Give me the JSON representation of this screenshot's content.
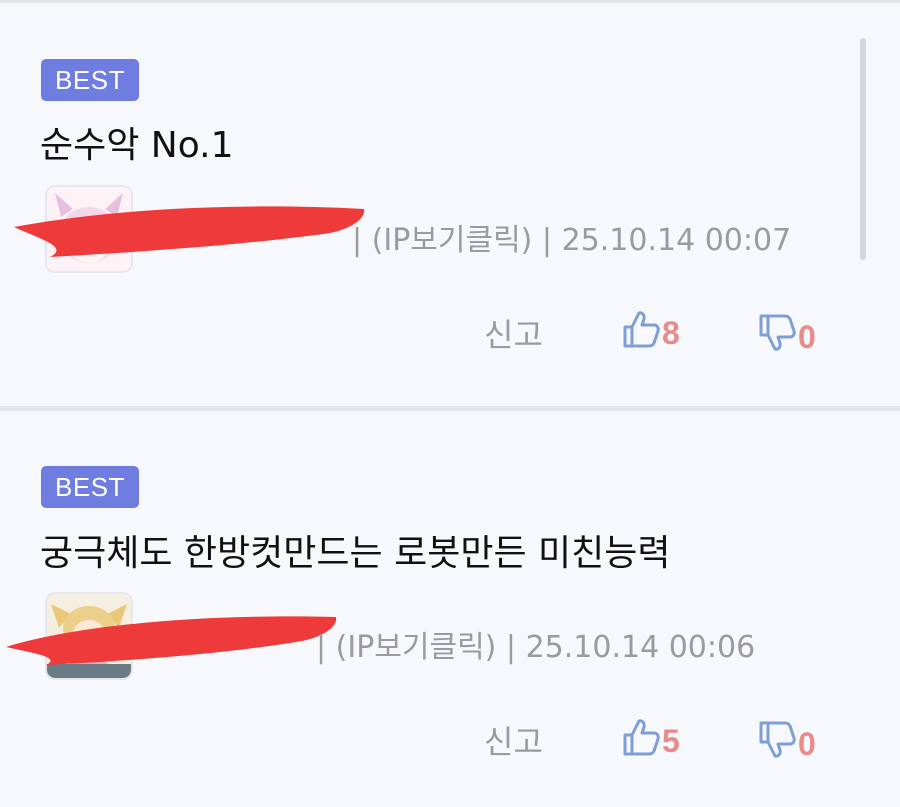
{
  "comments": [
    {
      "badge": "BEST",
      "title": "순수악 No.1",
      "meta": "| (IP보기클릭) | 25.10.14 00:07",
      "report_label": "신고",
      "upvotes": "8",
      "downvotes": "0"
    },
    {
      "badge": "BEST",
      "title": "궁극체도 한방컷만드는 로봇만든 미친능력",
      "meta": "| (IP보기클릭) | 25.10.14 00:06",
      "report_label": "신고",
      "upvotes": "5",
      "downvotes": "0"
    }
  ],
  "icons": {
    "thumbs_up": "thumbs-up-icon",
    "thumbs_down": "thumbs-down-icon"
  },
  "colors": {
    "badge_bg": "#6f7de0",
    "vote_icon": "#7d9fd6",
    "vote_count": "#e88b8b",
    "redaction": "#ee3a3a",
    "meta_text": "#9a9a9f"
  }
}
